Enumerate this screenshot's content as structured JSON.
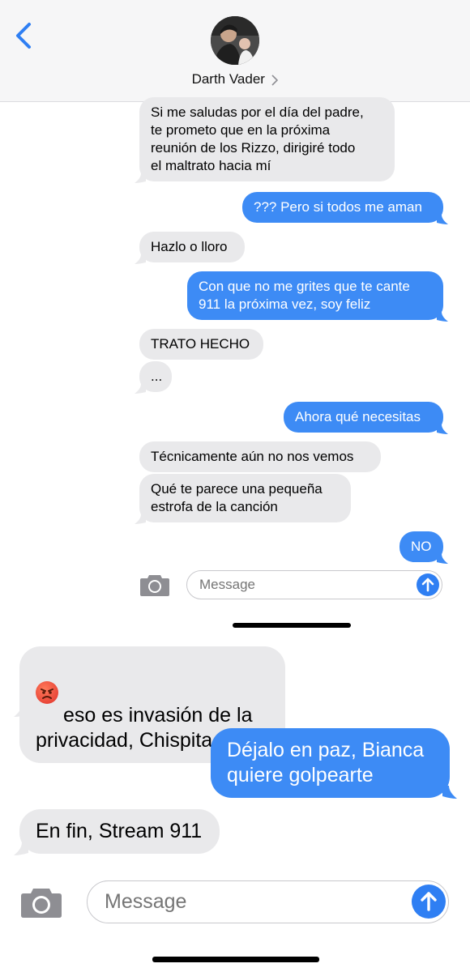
{
  "header": {
    "contact_name": "Darth Vader"
  },
  "screenshot1": {
    "messages": [
      {
        "dir": "in",
        "text": "Si me saludas por el día del padre,\nte prometo que en la próxima\nreunión de los Rizzo, dirigiré todo\nel maltrato hacia mí"
      },
      {
        "dir": "out",
        "text": "??? Pero si todos me aman"
      },
      {
        "dir": "in",
        "text": "Hazlo o lloro"
      },
      {
        "dir": "out",
        "text": "Con que no me grites que te cante\n911 la próxima vez, soy feliz"
      },
      {
        "dir": "in",
        "text": "TRATO HECHO"
      },
      {
        "dir": "in",
        "text": "..."
      },
      {
        "dir": "out",
        "text": "Ahora qué necesitas"
      },
      {
        "dir": "in",
        "text": "Técnicamente aún no nos vemos"
      },
      {
        "dir": "in",
        "text": "Qué te parece una pequeña\nestrofa de la canción"
      },
      {
        "dir": "out",
        "text": "NO"
      }
    ],
    "input_placeholder": "Message"
  },
  "screenshot2": {
    "emoji": "angry-face",
    "messages": [
      {
        "dir": "in",
        "text": "eso es invasión de la\nprivacidad, Chispita"
      },
      {
        "dir": "out",
        "text": "Déjalo en paz, Bianca\nquiere golpearte"
      },
      {
        "dir": "in",
        "text": "En fin, Stream 911"
      }
    ],
    "input_placeholder": "Message"
  },
  "colors": {
    "incoming_bubble": "#e9e9eb",
    "outgoing_bubble": "#3d8bf5",
    "accent": "#2f7ff3"
  }
}
